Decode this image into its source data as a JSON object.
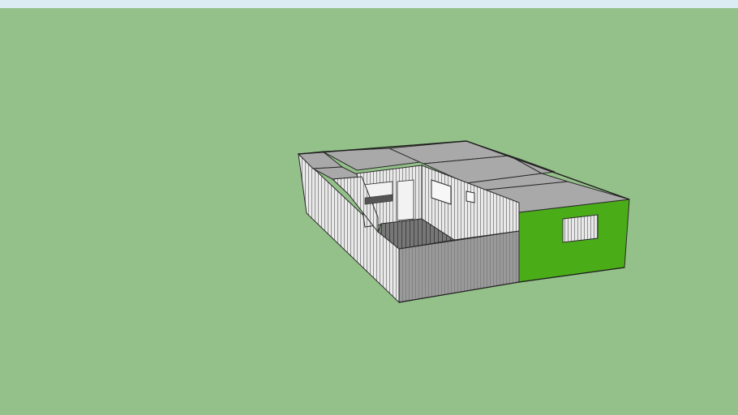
{
  "colors": {
    "sky": "#dcecf4",
    "ground": "#94c08a",
    "roof": "#a9a9a9",
    "roof_dark": "#8f8f8f",
    "wall_light": "#e6e6e6",
    "wall_front": "#9a9a9a",
    "wall_shadow": "#8a8a8a",
    "accent_wall": "#4aad18",
    "edge": "#2a2a2a",
    "interior": "#f2f2f2",
    "floor": "#6f6f6f"
  },
  "icons": {
    "model": "3d-building-model-icon"
  }
}
